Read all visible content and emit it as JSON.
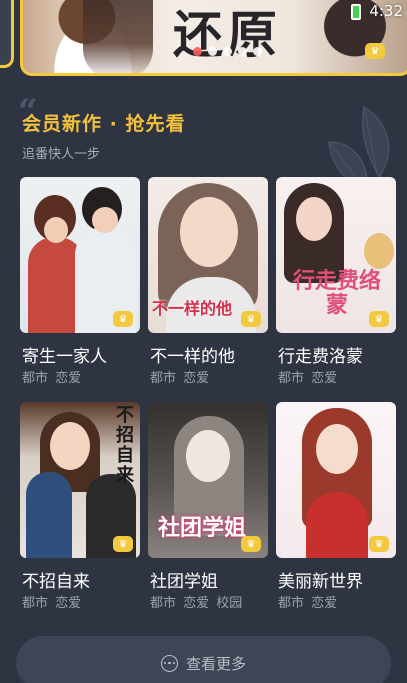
{
  "status_bar": {
    "time": "4:32"
  },
  "banner": {
    "title": "还原",
    "dots": 5,
    "active_dot": 0,
    "accent_color": "#f3c940"
  },
  "section": {
    "title": "会员新作 · 抢先看",
    "subtitle": "追番快人一步",
    "title_color": "#f3c23c"
  },
  "comics": [
    {
      "title": "寄生一家人",
      "tags": "都市 恋爱",
      "badge_icon": "crown-icon"
    },
    {
      "title": "不一样的他",
      "tags": "都市 恋爱",
      "cover_text": "不一样的他",
      "badge_icon": "crown-icon"
    },
    {
      "title": "行走费洛蒙",
      "tags": "都市 恋爱",
      "cover_text": "行走费络蒙",
      "badge_icon": "crown-icon"
    },
    {
      "title": "不招自来",
      "tags": "都市 恋爱",
      "cover_text": "不招自来",
      "badge_icon": "crown-icon"
    },
    {
      "title": "社团学姐",
      "tags": "都市 恋爱 校园",
      "cover_text": "社团学姐",
      "badge_icon": "crown-icon"
    },
    {
      "title": "美丽新世界",
      "tags": "都市 恋爱",
      "badge_icon": "crown-icon"
    }
  ],
  "more_button": {
    "label": "查看更多",
    "icon": "more-dots-icon"
  }
}
